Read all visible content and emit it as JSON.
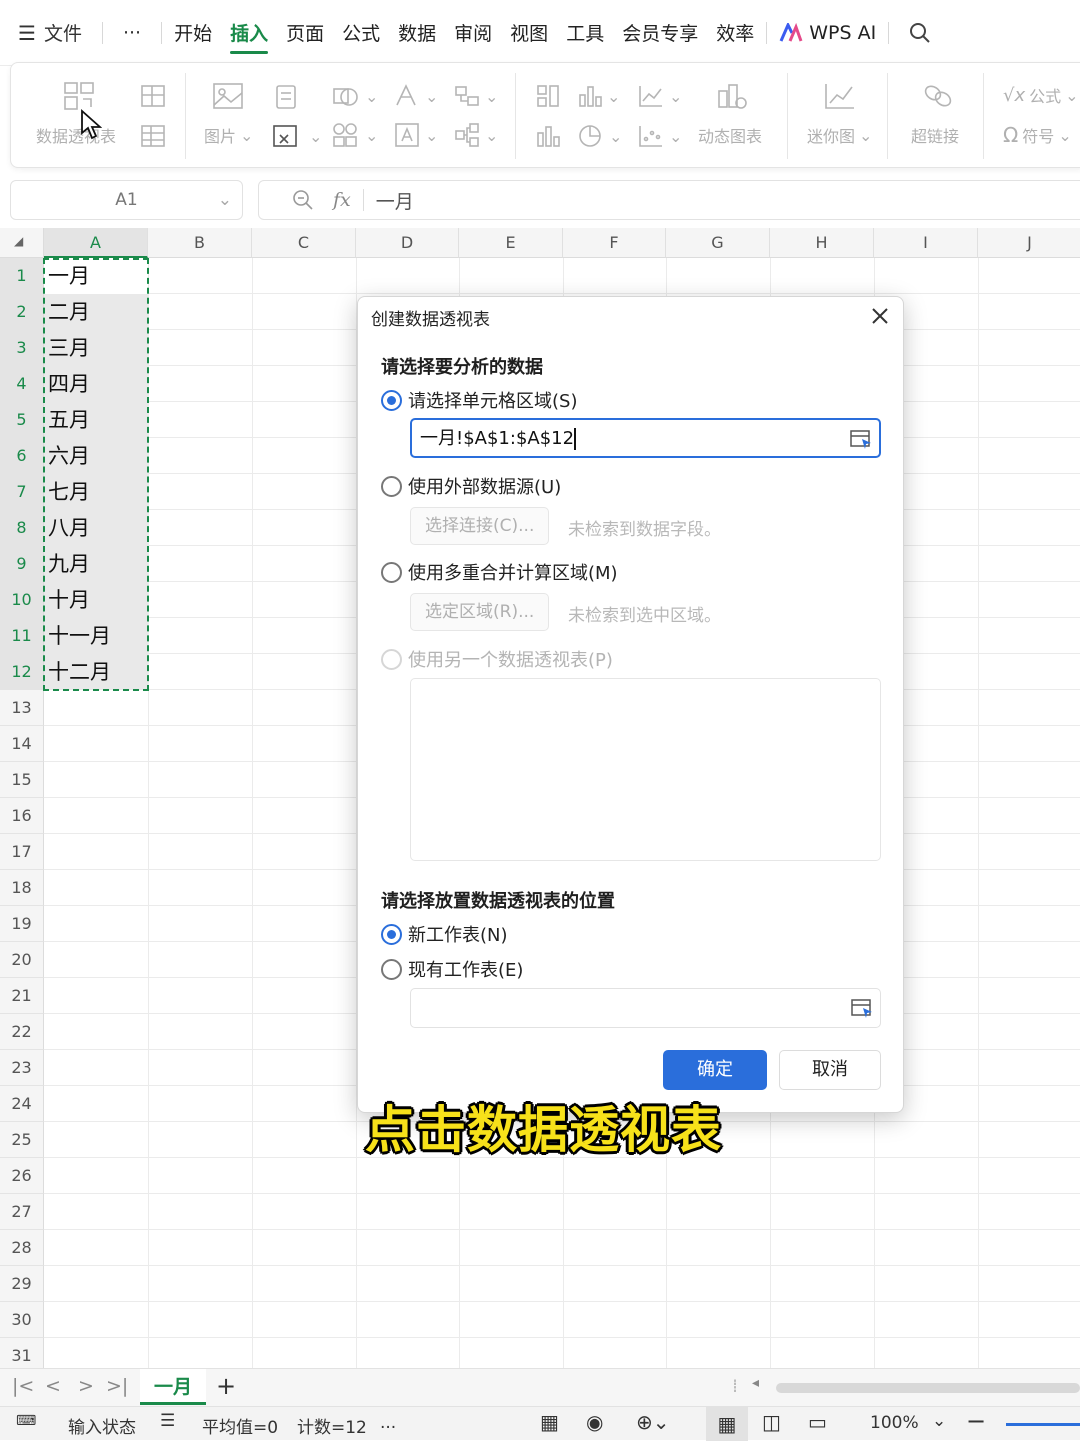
{
  "menubar": {
    "file_label": "文件",
    "more_label": "···",
    "tabs": [
      "开始",
      "插入",
      "页面",
      "公式",
      "数据",
      "审阅",
      "视图",
      "工具",
      "会员专享",
      "效率"
    ],
    "active_tab": "插入",
    "wps_ai": "WPS AI"
  },
  "ribbon": {
    "pivot_table": "数据透视表",
    "picture": "图片",
    "dynamic_chart": "动态图表",
    "sparkline": "迷你图",
    "hyperlink": "超链接",
    "formula": "公式",
    "symbol": "符号"
  },
  "formula_bar": {
    "name_box": "A1",
    "fx": "fx",
    "content": "一月"
  },
  "grid": {
    "columns": [
      "A",
      "B",
      "C",
      "D",
      "E",
      "F",
      "G",
      "H",
      "I",
      "J"
    ],
    "rows": [
      "1",
      "2",
      "3",
      "4",
      "5",
      "6",
      "7",
      "8",
      "9",
      "10",
      "11",
      "12",
      "13",
      "14",
      "15",
      "16",
      "17",
      "18",
      "19",
      "20",
      "21",
      "22",
      "23",
      "24",
      "25",
      "26",
      "27",
      "28",
      "29",
      "30",
      "31"
    ],
    "column_a_values": [
      "一月",
      "二月",
      "三月",
      "四月",
      "五月",
      "六月",
      "七月",
      "八月",
      "九月",
      "十月",
      "十一月",
      "十二月"
    ]
  },
  "dialog": {
    "title": "创建数据透视表",
    "section1": "请选择要分析的数据",
    "opt_range": "请选择单元格区域(S)",
    "range_value": "一月!$A$1:$A$12",
    "opt_external": "使用外部数据源(U)",
    "btn_select_conn": "选择连接(C)...",
    "hint_no_fields": "未检索到数据字段。",
    "opt_multi": "使用多重合并计算区域(M)",
    "btn_select_range": "选定区域(R)...",
    "hint_no_range": "未检索到选中区域。",
    "opt_other_pivot": "使用另一个数据透视表(P)",
    "section2": "请选择放置数据透视表的位置",
    "opt_new_sheet": "新工作表(N)",
    "opt_existing": "现有工作表(E)",
    "ok": "确定",
    "cancel": "取消"
  },
  "caption": "点击数据透视表",
  "sheet_tabs": {
    "active_sheet": "一月",
    "add": "+"
  },
  "statusbar": {
    "input_state": "输入状态",
    "average": "平均值=0",
    "count": "计数=12",
    "ellipsis": "...",
    "zoom": "100%"
  }
}
